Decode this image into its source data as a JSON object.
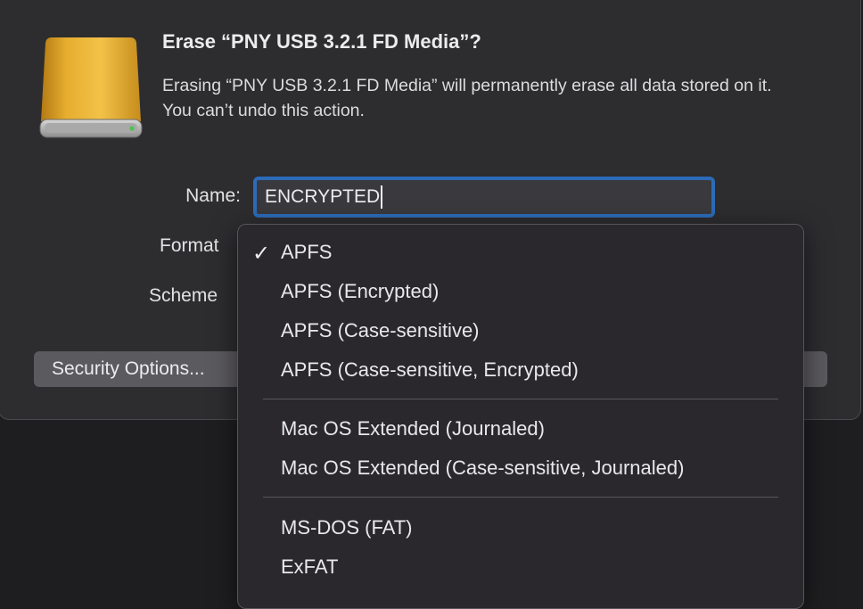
{
  "dialog": {
    "title": "Erase “PNY USB 3.2.1 FD Media”?",
    "message": "Erasing “PNY USB 3.2.1 FD Media” will permanently erase all data stored on it. You can’t undo this action.",
    "icon": "external-drive-icon",
    "colors": {
      "drive_body": "#e0a526",
      "accent_border": "#2c6bb8",
      "led": "#4fc152"
    }
  },
  "form": {
    "name_label": "Name:",
    "name_value": "ENCRYPTED",
    "format_label": "Format",
    "scheme_label": "Scheme"
  },
  "buttons": {
    "security_options": "Security Options..."
  },
  "format_menu": {
    "selected": "APFS",
    "check_glyph": "✓",
    "items": [
      {
        "label": "APFS"
      },
      {
        "label": "APFS (Encrypted)"
      },
      {
        "label": "APFS (Case-sensitive)"
      },
      {
        "label": "APFS (Case-sensitive, Encrypted)"
      },
      {
        "label": "Mac OS Extended (Journaled)"
      },
      {
        "label": "Mac OS Extended (Case-sensitive, Journaled)"
      },
      {
        "label": "MS-DOS (FAT)"
      },
      {
        "label": "ExFAT"
      }
    ]
  }
}
